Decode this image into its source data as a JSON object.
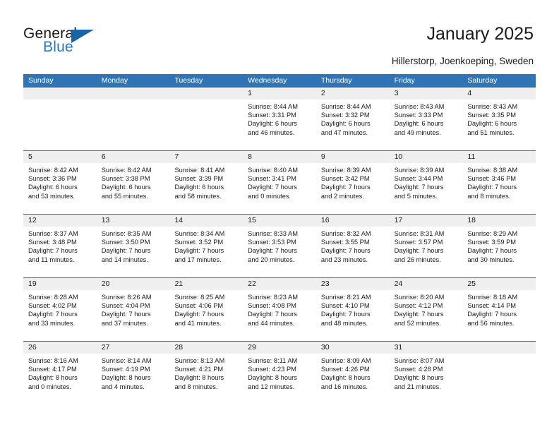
{
  "brand": {
    "name_part1": "General",
    "name_part2": "Blue"
  },
  "header": {
    "title": "January 2025",
    "subtitle": "Hillerstorp, Joenkoeping, Sweden"
  },
  "colors": {
    "header_blue": "#2f75b5",
    "logo_blue": "#2577c0",
    "logo_triangle": "#1565a8",
    "day_strip_gray": "#efefef"
  },
  "weekdays": [
    "Sunday",
    "Monday",
    "Tuesday",
    "Wednesday",
    "Thursday",
    "Friday",
    "Saturday"
  ],
  "weeks": [
    [
      {
        "day": "",
        "sunrise": "",
        "sunset": "",
        "daylight_line1": "",
        "daylight_line2": ""
      },
      {
        "day": "",
        "sunrise": "",
        "sunset": "",
        "daylight_line1": "",
        "daylight_line2": ""
      },
      {
        "day": "",
        "sunrise": "",
        "sunset": "",
        "daylight_line1": "",
        "daylight_line2": ""
      },
      {
        "day": "1",
        "sunrise": "Sunrise: 8:44 AM",
        "sunset": "Sunset: 3:31 PM",
        "daylight_line1": "Daylight: 6 hours",
        "daylight_line2": "and 46 minutes."
      },
      {
        "day": "2",
        "sunrise": "Sunrise: 8:44 AM",
        "sunset": "Sunset: 3:32 PM",
        "daylight_line1": "Daylight: 6 hours",
        "daylight_line2": "and 47 minutes."
      },
      {
        "day": "3",
        "sunrise": "Sunrise: 8:43 AM",
        "sunset": "Sunset: 3:33 PM",
        "daylight_line1": "Daylight: 6 hours",
        "daylight_line2": "and 49 minutes."
      },
      {
        "day": "4",
        "sunrise": "Sunrise: 8:43 AM",
        "sunset": "Sunset: 3:35 PM",
        "daylight_line1": "Daylight: 6 hours",
        "daylight_line2": "and 51 minutes."
      }
    ],
    [
      {
        "day": "5",
        "sunrise": "Sunrise: 8:42 AM",
        "sunset": "Sunset: 3:36 PM",
        "daylight_line1": "Daylight: 6 hours",
        "daylight_line2": "and 53 minutes."
      },
      {
        "day": "6",
        "sunrise": "Sunrise: 8:42 AM",
        "sunset": "Sunset: 3:38 PM",
        "daylight_line1": "Daylight: 6 hours",
        "daylight_line2": "and 55 minutes."
      },
      {
        "day": "7",
        "sunrise": "Sunrise: 8:41 AM",
        "sunset": "Sunset: 3:39 PM",
        "daylight_line1": "Daylight: 6 hours",
        "daylight_line2": "and 58 minutes."
      },
      {
        "day": "8",
        "sunrise": "Sunrise: 8:40 AM",
        "sunset": "Sunset: 3:41 PM",
        "daylight_line1": "Daylight: 7 hours",
        "daylight_line2": "and 0 minutes."
      },
      {
        "day": "9",
        "sunrise": "Sunrise: 8:39 AM",
        "sunset": "Sunset: 3:42 PM",
        "daylight_line1": "Daylight: 7 hours",
        "daylight_line2": "and 2 minutes."
      },
      {
        "day": "10",
        "sunrise": "Sunrise: 8:39 AM",
        "sunset": "Sunset: 3:44 PM",
        "daylight_line1": "Daylight: 7 hours",
        "daylight_line2": "and 5 minutes."
      },
      {
        "day": "11",
        "sunrise": "Sunrise: 8:38 AM",
        "sunset": "Sunset: 3:46 PM",
        "daylight_line1": "Daylight: 7 hours",
        "daylight_line2": "and 8 minutes."
      }
    ],
    [
      {
        "day": "12",
        "sunrise": "Sunrise: 8:37 AM",
        "sunset": "Sunset: 3:48 PM",
        "daylight_line1": "Daylight: 7 hours",
        "daylight_line2": "and 11 minutes."
      },
      {
        "day": "13",
        "sunrise": "Sunrise: 8:35 AM",
        "sunset": "Sunset: 3:50 PM",
        "daylight_line1": "Daylight: 7 hours",
        "daylight_line2": "and 14 minutes."
      },
      {
        "day": "14",
        "sunrise": "Sunrise: 8:34 AM",
        "sunset": "Sunset: 3:52 PM",
        "daylight_line1": "Daylight: 7 hours",
        "daylight_line2": "and 17 minutes."
      },
      {
        "day": "15",
        "sunrise": "Sunrise: 8:33 AM",
        "sunset": "Sunset: 3:53 PM",
        "daylight_line1": "Daylight: 7 hours",
        "daylight_line2": "and 20 minutes."
      },
      {
        "day": "16",
        "sunrise": "Sunrise: 8:32 AM",
        "sunset": "Sunset: 3:55 PM",
        "daylight_line1": "Daylight: 7 hours",
        "daylight_line2": "and 23 minutes."
      },
      {
        "day": "17",
        "sunrise": "Sunrise: 8:31 AM",
        "sunset": "Sunset: 3:57 PM",
        "daylight_line1": "Daylight: 7 hours",
        "daylight_line2": "and 26 minutes."
      },
      {
        "day": "18",
        "sunrise": "Sunrise: 8:29 AM",
        "sunset": "Sunset: 3:59 PM",
        "daylight_line1": "Daylight: 7 hours",
        "daylight_line2": "and 30 minutes."
      }
    ],
    [
      {
        "day": "19",
        "sunrise": "Sunrise: 8:28 AM",
        "sunset": "Sunset: 4:02 PM",
        "daylight_line1": "Daylight: 7 hours",
        "daylight_line2": "and 33 minutes."
      },
      {
        "day": "20",
        "sunrise": "Sunrise: 8:26 AM",
        "sunset": "Sunset: 4:04 PM",
        "daylight_line1": "Daylight: 7 hours",
        "daylight_line2": "and 37 minutes."
      },
      {
        "day": "21",
        "sunrise": "Sunrise: 8:25 AM",
        "sunset": "Sunset: 4:06 PM",
        "daylight_line1": "Daylight: 7 hours",
        "daylight_line2": "and 41 minutes."
      },
      {
        "day": "22",
        "sunrise": "Sunrise: 8:23 AM",
        "sunset": "Sunset: 4:08 PM",
        "daylight_line1": "Daylight: 7 hours",
        "daylight_line2": "and 44 minutes."
      },
      {
        "day": "23",
        "sunrise": "Sunrise: 8:21 AM",
        "sunset": "Sunset: 4:10 PM",
        "daylight_line1": "Daylight: 7 hours",
        "daylight_line2": "and 48 minutes."
      },
      {
        "day": "24",
        "sunrise": "Sunrise: 8:20 AM",
        "sunset": "Sunset: 4:12 PM",
        "daylight_line1": "Daylight: 7 hours",
        "daylight_line2": "and 52 minutes."
      },
      {
        "day": "25",
        "sunrise": "Sunrise: 8:18 AM",
        "sunset": "Sunset: 4:14 PM",
        "daylight_line1": "Daylight: 7 hours",
        "daylight_line2": "and 56 minutes."
      }
    ],
    [
      {
        "day": "26",
        "sunrise": "Sunrise: 8:16 AM",
        "sunset": "Sunset: 4:17 PM",
        "daylight_line1": "Daylight: 8 hours",
        "daylight_line2": "and 0 minutes."
      },
      {
        "day": "27",
        "sunrise": "Sunrise: 8:14 AM",
        "sunset": "Sunset: 4:19 PM",
        "daylight_line1": "Daylight: 8 hours",
        "daylight_line2": "and 4 minutes."
      },
      {
        "day": "28",
        "sunrise": "Sunrise: 8:13 AM",
        "sunset": "Sunset: 4:21 PM",
        "daylight_line1": "Daylight: 8 hours",
        "daylight_line2": "and 8 minutes."
      },
      {
        "day": "29",
        "sunrise": "Sunrise: 8:11 AM",
        "sunset": "Sunset: 4:23 PM",
        "daylight_line1": "Daylight: 8 hours",
        "daylight_line2": "and 12 minutes."
      },
      {
        "day": "30",
        "sunrise": "Sunrise: 8:09 AM",
        "sunset": "Sunset: 4:26 PM",
        "daylight_line1": "Daylight: 8 hours",
        "daylight_line2": "and 16 minutes."
      },
      {
        "day": "31",
        "sunrise": "Sunrise: 8:07 AM",
        "sunset": "Sunset: 4:28 PM",
        "daylight_line1": "Daylight: 8 hours",
        "daylight_line2": "and 21 minutes."
      },
      {
        "day": "",
        "sunrise": "",
        "sunset": "",
        "daylight_line1": "",
        "daylight_line2": ""
      }
    ]
  ]
}
